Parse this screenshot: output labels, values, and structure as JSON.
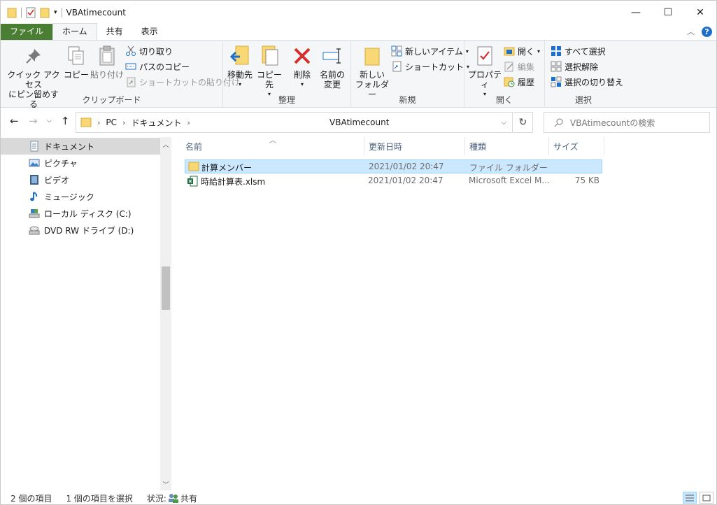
{
  "window": {
    "title": "VBAtimecount",
    "minimize": "—",
    "maximize": "☐",
    "close": "✕"
  },
  "ribbon_tabs": [
    "ファイル",
    "ホーム",
    "共有",
    "表示"
  ],
  "ribbon": {
    "clipboard": {
      "label": "クリップボード",
      "pin_line1": "クイック アクセス",
      "pin_line2": "にピン留めする",
      "copy": "コピー",
      "paste": "貼り付け",
      "cut": "切り取り",
      "copy_path": "パスのコピー",
      "paste_shortcut": "ショートカットの貼り付け"
    },
    "organize": {
      "label": "整理",
      "move_to": "移動先",
      "copy_to": "コピー先",
      "delete": "削除",
      "rename_line1": "名前の",
      "rename_line2": "変更"
    },
    "new": {
      "label": "新規",
      "new_folder_line1": "新しい",
      "new_folder_line2": "フォルダー",
      "new_item": "新しいアイテム",
      "shortcut": "ショートカット"
    },
    "open": {
      "label": "開く",
      "properties": "プロパティ",
      "open": "開く",
      "edit": "編集",
      "history": "履歴"
    },
    "select": {
      "label": "選択",
      "select_all": "すべて選択",
      "select_none": "選択解除",
      "invert": "選択の切り替え"
    }
  },
  "address": {
    "crumbs": [
      "PC",
      "ドキュメント"
    ],
    "current": "VBAtimecount",
    "search_placeholder": "VBAtimecountの検索"
  },
  "nav": [
    {
      "label": "ドキュメント",
      "icon": "documents-icon",
      "selected": true
    },
    {
      "label": "ピクチャ",
      "icon": "pictures-icon",
      "selected": false
    },
    {
      "label": "ビデオ",
      "icon": "videos-icon",
      "selected": false
    },
    {
      "label": "ミュージック",
      "icon": "music-icon",
      "selected": false
    },
    {
      "label": "ローカル ディスク (C:)",
      "icon": "local-disk-icon",
      "selected": false
    },
    {
      "label": "DVD RW ドライブ (D:)",
      "icon": "dvd-drive-icon",
      "selected": false
    }
  ],
  "columns": [
    "名前",
    "更新日時",
    "種類",
    "サイズ"
  ],
  "files": [
    {
      "name": "計算メンバー",
      "modified": "2021/01/02 20:47",
      "type": "ファイル フォルダー",
      "size": "",
      "icon": "folder-icon",
      "selected": true
    },
    {
      "name": "時給計算表.xlsm",
      "modified": "2021/01/02 20:47",
      "type": "Microsoft Excel M...",
      "size": "75 KB",
      "icon": "excel-file-icon",
      "selected": false
    }
  ],
  "status": {
    "count": "2 個の項目",
    "selected": "1 個の項目を選択",
    "state_label": "状況:",
    "state_value": "共有"
  },
  "colors": {
    "file_tab": "#4a7f33",
    "selection": "#cce8ff",
    "folder": "#f8d775",
    "delete_red": "#d32f2f"
  }
}
